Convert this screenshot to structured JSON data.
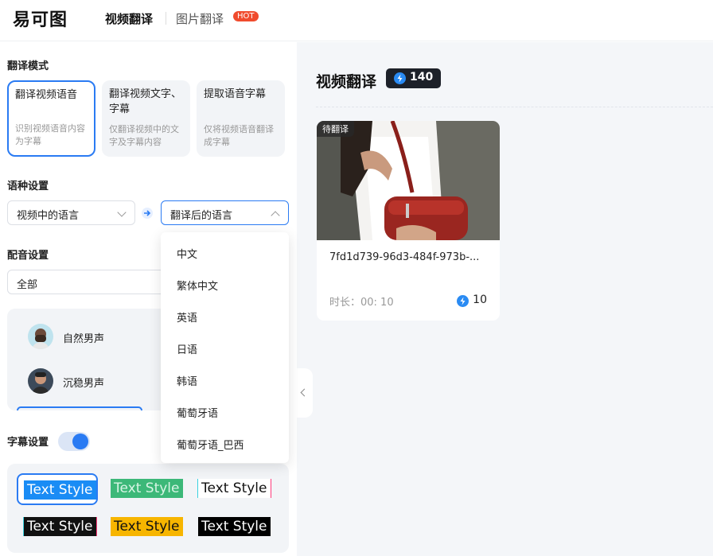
{
  "header": {
    "logo": "易可图",
    "tabs": [
      {
        "label": "视频翻译",
        "active": true
      },
      {
        "label": "图片翻译",
        "badge": "HOT"
      }
    ]
  },
  "settings": {
    "mode_title": "翻译模式",
    "modes": [
      {
        "title": "翻译视频语音",
        "desc": "识别视频语音内容为字幕",
        "selected": true
      },
      {
        "title": "翻译视频文字、字幕",
        "desc": "仅翻译视频中的文字及字幕内容",
        "selected": false
      },
      {
        "title": "提取语音字幕",
        "desc": "仅将视频语音翻译成字幕",
        "selected": false
      }
    ],
    "language_title": "语种设置",
    "source_language": "视频中的语言",
    "target_language_placeholder": "翻译后的语言",
    "dubbing_title": "配音设置",
    "dubbing_filter": "全部",
    "voices": [
      {
        "name": "自然男声"
      },
      {
        "name": "沉稳男声"
      }
    ],
    "subtitle_title": "字幕设置",
    "subtitle_enabled": true,
    "text_styles": [
      "Text Style",
      "Text Style",
      "Text Style",
      "Text Style",
      "Text Style",
      "Text Style"
    ]
  },
  "language_dropdown": {
    "options": [
      "中文",
      "繁体中文",
      "英语",
      "日语",
      "韩语",
      "葡萄牙语",
      "葡萄牙语_巴西"
    ]
  },
  "main": {
    "title": "视频翻译",
    "credits": "140",
    "tasks": [
      {
        "status": "待翻译",
        "name": "7fd1d739-96d3-484f-973b-...",
        "duration": "时长：00: 10",
        "cost": "10"
      }
    ]
  },
  "colors": {
    "accent": "#2a7bf3",
    "hot": "#f04b2d",
    "credit_bg": "#1d2129"
  }
}
